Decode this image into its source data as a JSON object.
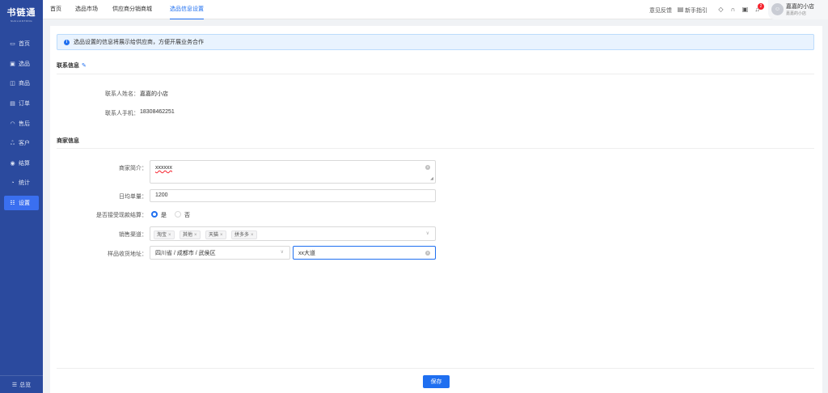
{
  "app": {
    "logo_text": "书链通",
    "logo_sub": "SHULIANTONG"
  },
  "sidebar": {
    "items": [
      {
        "label": "首页",
        "icon": "monitor-icon"
      },
      {
        "label": "选品",
        "icon": "box-icon"
      },
      {
        "label": "商品",
        "icon": "tag-icon"
      },
      {
        "label": "订单",
        "icon": "order-icon"
      },
      {
        "label": "售后",
        "icon": "headset-icon"
      },
      {
        "label": "客户",
        "icon": "users-icon"
      },
      {
        "label": "结算",
        "icon": "coin-icon"
      },
      {
        "label": "统计",
        "icon": "chart-icon"
      },
      {
        "label": "设置",
        "icon": "settings-icon"
      }
    ],
    "active_index": 8,
    "collapse_label": "总览"
  },
  "header": {
    "tabs": [
      {
        "label": "首页"
      },
      {
        "label": "选品市场"
      },
      {
        "label": "供应商分销商城"
      },
      {
        "label": "选品信息设置"
      }
    ],
    "active_tab": 3,
    "feedback_label": "意见反馈",
    "guide_label": "新手指引",
    "notification_count": "2",
    "user_name": "嘉嘉的小店",
    "user_sub": "嘉嘉的小店"
  },
  "main": {
    "notice": "选品设置的信息将展示给供应商，方便开展业务合作",
    "contact": {
      "title": "联系信息",
      "name_label": "联系人姓名：",
      "name_value": "嘉嘉的小店",
      "phone_label": "联系人手机：",
      "phone_value": "18308462251"
    },
    "merchant": {
      "title": "商家信息",
      "intro_label": "商家简介：",
      "intro_value": "xxxxxx",
      "orders_label": "日均单量：",
      "orders_value": "1200",
      "cod_label": "是否接受现款结算：",
      "cod_options": [
        "是",
        "否"
      ],
      "cod_selected": "是",
      "channel_label": "销售渠道：",
      "channels": [
        "淘宝",
        "其他",
        "天猫",
        "拼多多"
      ],
      "address_label": "样品收货地址：",
      "region_value": "四川省 / 成都市 / 武侯区",
      "street_value": "xx大道"
    },
    "save_label": "保存"
  },
  "colors": {
    "sidebar_bg": "#2b4a9e",
    "accent": "#1f6ff0",
    "notice_bg": "#e9f3fe",
    "badge": "#f5222d"
  }
}
